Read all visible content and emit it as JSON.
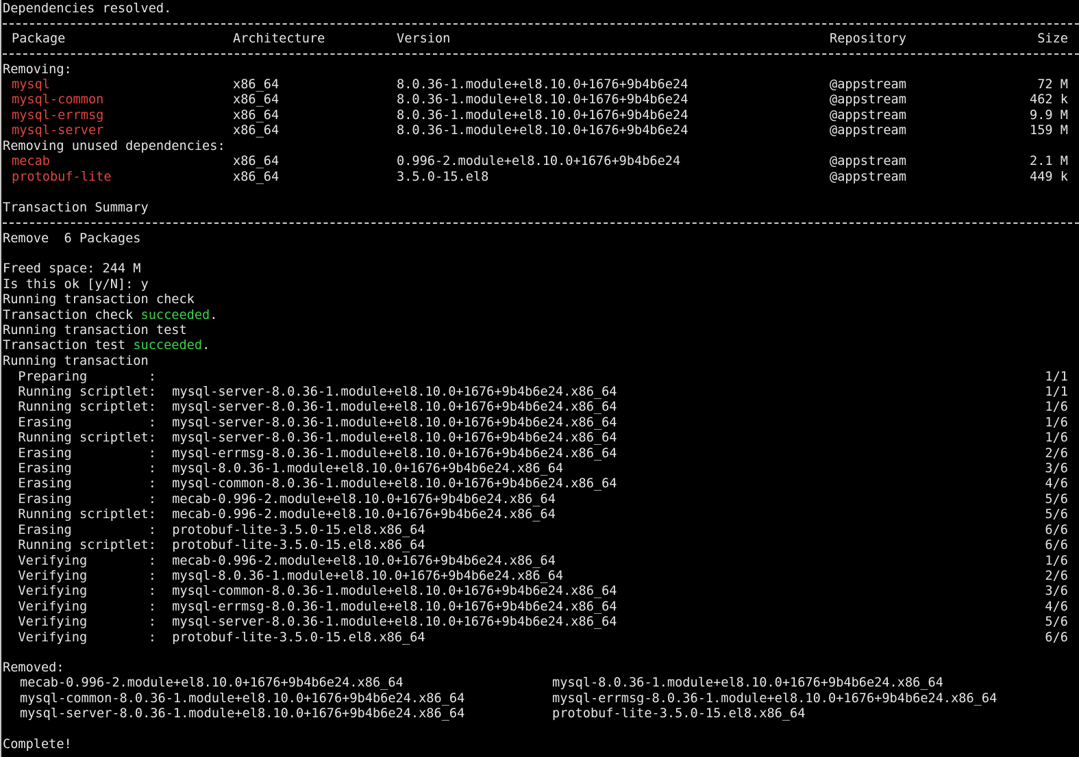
{
  "header": {
    "resolved": "Dependencies resolved."
  },
  "table": {
    "columns": [
      "Package",
      "Architecture",
      "Version",
      "Repository",
      "Size"
    ],
    "removing_label": "Removing:",
    "removing": [
      {
        "pkg": "mysql",
        "arch": "x86_64",
        "version": "8.0.36-1.module+el8.10.0+1676+9b4b6e24",
        "repo": "@appstream",
        "size": "72 M"
      },
      {
        "pkg": "mysql-common",
        "arch": "x86_64",
        "version": "8.0.36-1.module+el8.10.0+1676+9b4b6e24",
        "repo": "@appstream",
        "size": "462 k"
      },
      {
        "pkg": "mysql-errmsg",
        "arch": "x86_64",
        "version": "8.0.36-1.module+el8.10.0+1676+9b4b6e24",
        "repo": "@appstream",
        "size": "9.9 M"
      },
      {
        "pkg": "mysql-server",
        "arch": "x86_64",
        "version": "8.0.36-1.module+el8.10.0+1676+9b4b6e24",
        "repo": "@appstream",
        "size": "159 M"
      }
    ],
    "unused_label": "Removing unused dependencies:",
    "unused": [
      {
        "pkg": "mecab",
        "arch": "x86_64",
        "version": "0.996-2.module+el8.10.0+1676+9b4b6e24",
        "repo": "@appstream",
        "size": "2.1 M"
      },
      {
        "pkg": "protobuf-lite",
        "arch": "x86_64",
        "version": "3.5.0-15.el8",
        "repo": "@appstream",
        "size": "449 k"
      }
    ]
  },
  "summary": {
    "title": "Transaction Summary",
    "remove": "Remove  6 Packages",
    "freed": "Freed space: 244 M",
    "prompt": "Is this ok [y/N]: y"
  },
  "run": {
    "check_running": "Running transaction check",
    "check_prefix": "Transaction check ",
    "succeeded": "succeeded",
    "dot": ".",
    "test_running": "Running transaction test",
    "test_prefix": "Transaction test ",
    "running": "Running transaction"
  },
  "steps": [
    {
      "action": "  Preparing        :",
      "target": "",
      "count": "1/1"
    },
    {
      "action": "  Running scriptlet:",
      "target": " mysql-server-8.0.36-1.module+el8.10.0+1676+9b4b6e24.x86_64",
      "count": "1/1"
    },
    {
      "action": "  Running scriptlet:",
      "target": " mysql-server-8.0.36-1.module+el8.10.0+1676+9b4b6e24.x86_64",
      "count": "1/6"
    },
    {
      "action": "  Erasing          :",
      "target": " mysql-server-8.0.36-1.module+el8.10.0+1676+9b4b6e24.x86_64",
      "count": "1/6"
    },
    {
      "action": "  Running scriptlet:",
      "target": " mysql-server-8.0.36-1.module+el8.10.0+1676+9b4b6e24.x86_64",
      "count": "1/6"
    },
    {
      "action": "  Erasing          :",
      "target": " mysql-errmsg-8.0.36-1.module+el8.10.0+1676+9b4b6e24.x86_64",
      "count": "2/6"
    },
    {
      "action": "  Erasing          :",
      "target": " mysql-8.0.36-1.module+el8.10.0+1676+9b4b6e24.x86_64",
      "count": "3/6"
    },
    {
      "action": "  Erasing          :",
      "target": " mysql-common-8.0.36-1.module+el8.10.0+1676+9b4b6e24.x86_64",
      "count": "4/6"
    },
    {
      "action": "  Erasing          :",
      "target": " mecab-0.996-2.module+el8.10.0+1676+9b4b6e24.x86_64",
      "count": "5/6"
    },
    {
      "action": "  Running scriptlet:",
      "target": " mecab-0.996-2.module+el8.10.0+1676+9b4b6e24.x86_64",
      "count": "5/6"
    },
    {
      "action": "  Erasing          :",
      "target": " protobuf-lite-3.5.0-15.el8.x86_64",
      "count": "6/6"
    },
    {
      "action": "  Running scriptlet:",
      "target": " protobuf-lite-3.5.0-15.el8.x86_64",
      "count": "6/6"
    },
    {
      "action": "  Verifying        :",
      "target": " mecab-0.996-2.module+el8.10.0+1676+9b4b6e24.x86_64",
      "count": "1/6"
    },
    {
      "action": "  Verifying        :",
      "target": " mysql-8.0.36-1.module+el8.10.0+1676+9b4b6e24.x86_64",
      "count": "2/6"
    },
    {
      "action": "  Verifying        :",
      "target": " mysql-common-8.0.36-1.module+el8.10.0+1676+9b4b6e24.x86_64",
      "count": "3/6"
    },
    {
      "action": "  Verifying        :",
      "target": " mysql-errmsg-8.0.36-1.module+el8.10.0+1676+9b4b6e24.x86_64",
      "count": "4/6"
    },
    {
      "action": "  Verifying        :",
      "target": " mysql-server-8.0.36-1.module+el8.10.0+1676+9b4b6e24.x86_64",
      "count": "5/6"
    },
    {
      "action": "  Verifying        :",
      "target": " protobuf-lite-3.5.0-15.el8.x86_64",
      "count": "6/6"
    }
  ],
  "removed": {
    "label": "Removed:",
    "rows": [
      [
        "mecab-0.996-2.module+el8.10.0+1676+9b4b6e24.x86_64",
        "mysql-8.0.36-1.module+el8.10.0+1676+9b4b6e24.x86_64"
      ],
      [
        "mysql-common-8.0.36-1.module+el8.10.0+1676+9b4b6e24.x86_64",
        "mysql-errmsg-8.0.36-1.module+el8.10.0+1676+9b4b6e24.x86_64"
      ],
      [
        "mysql-server-8.0.36-1.module+el8.10.0+1676+9b4b6e24.x86_64",
        "protobuf-lite-3.5.0-15.el8.x86_64"
      ]
    ]
  },
  "complete": "Complete!",
  "colors": {
    "background": "#000000",
    "text": "#e6e6e6",
    "package_name": "#e0463c",
    "success": "#3bd24a"
  }
}
